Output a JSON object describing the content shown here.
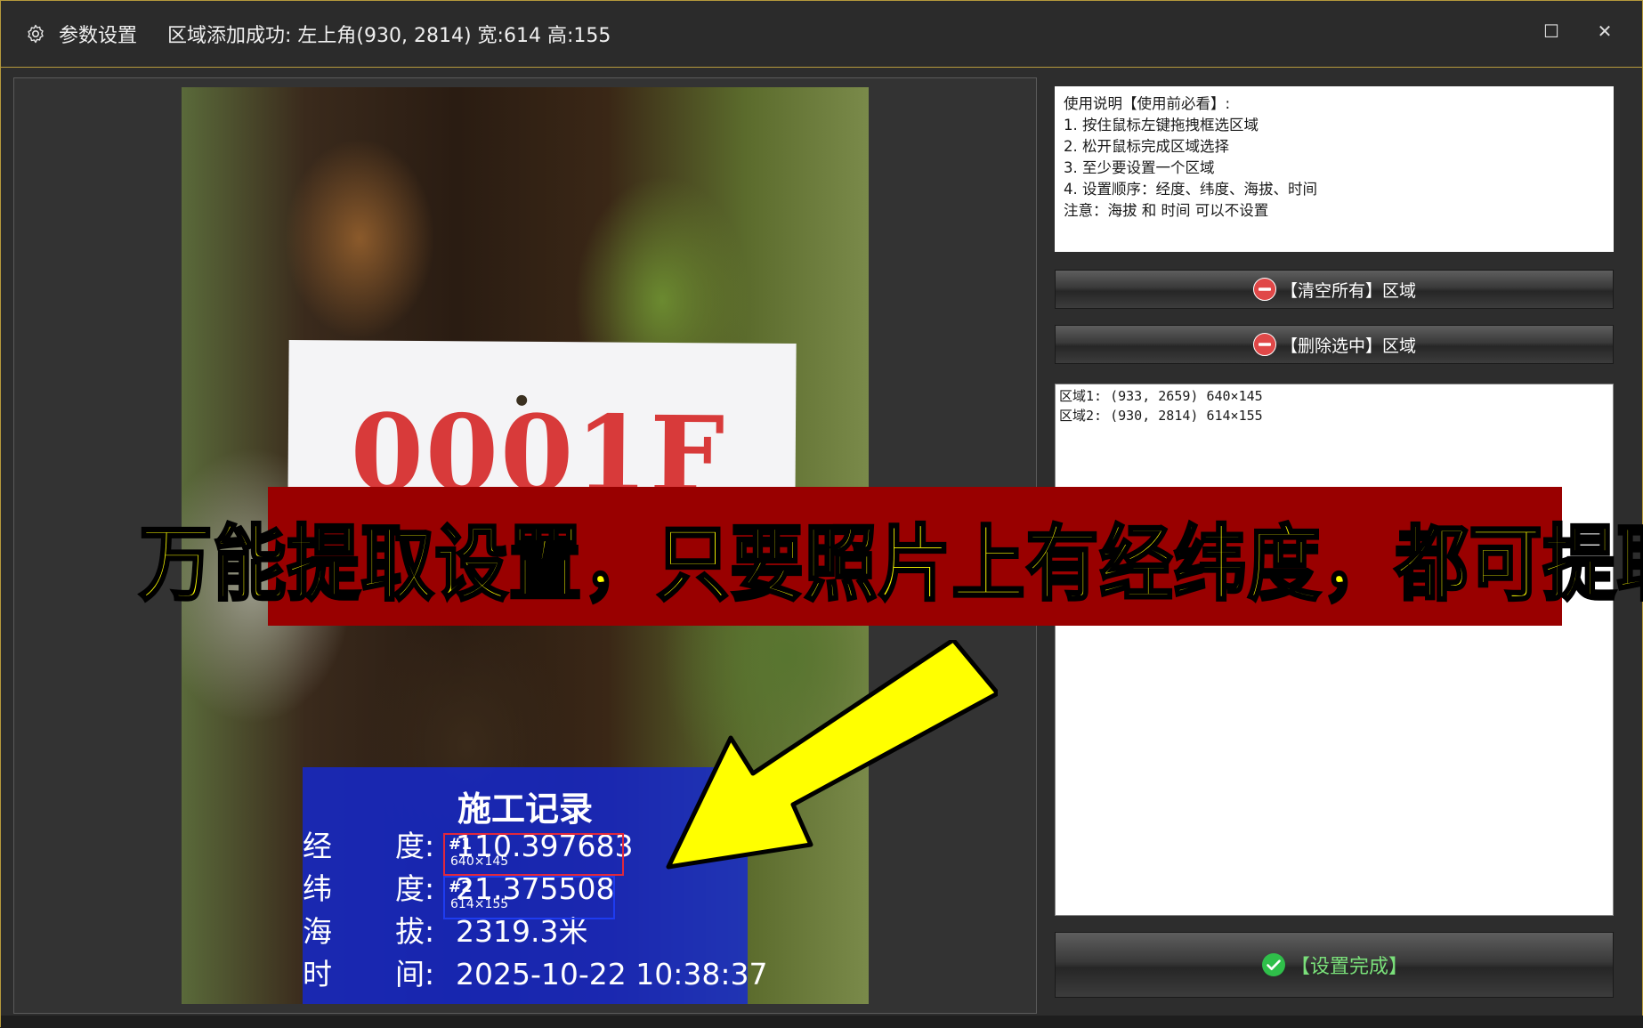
{
  "window": {
    "title": "参数设置",
    "status": "区域添加成功: 左上角(930, 2814) 宽:614 高:155",
    "maximize_glyph": "☐",
    "close_glyph": "✕"
  },
  "photo": {
    "sign_text": "0001F",
    "record": {
      "title": "施工记录",
      "rows": [
        {
          "l1": "经",
          "l2": "度:",
          "value": "110.397683"
        },
        {
          "l1": "纬",
          "l2": "度:",
          "value": "21.375508"
        },
        {
          "l1": "海",
          "l2": "拔:",
          "value": "2319.3米"
        },
        {
          "l1": "时",
          "l2": "间:",
          "value": "2025-10-22 10:38:37"
        }
      ]
    },
    "selections": [
      {
        "tag": "#1",
        "dims": "640×145",
        "color": "#e0283c"
      },
      {
        "tag": "#2",
        "dims": "614×155",
        "color": "#1e3cf0"
      }
    ]
  },
  "help": {
    "lines": [
      "使用说明【使用前必看】:",
      "1. 按住鼠标左键拖拽框选区域",
      "2. 松开鼠标完成区域选择",
      "3. 至少要设置一个区域",
      "4. 设置顺序：经度、纬度、海拔、时间",
      "注意：海拔 和 时间 可以不设置"
    ]
  },
  "buttons": {
    "clear_all": "【清空所有】区域",
    "delete_selected": "【删除选中】区域",
    "done": "【设置完成】"
  },
  "regions": [
    "区域1: (933, 2659) 640×145",
    "区域2: (930, 2814) 614×155"
  ],
  "banner": {
    "text": "万能提取设置，只要照片上有经纬度，都可提取"
  },
  "colors": {
    "accent_border": "#b69a3c",
    "banner_bg": "#990000",
    "banner_text": "#ffff00",
    "done_text": "#7ae07a",
    "minus_icon": "#e04848",
    "check_icon": "#2fbf4a"
  }
}
